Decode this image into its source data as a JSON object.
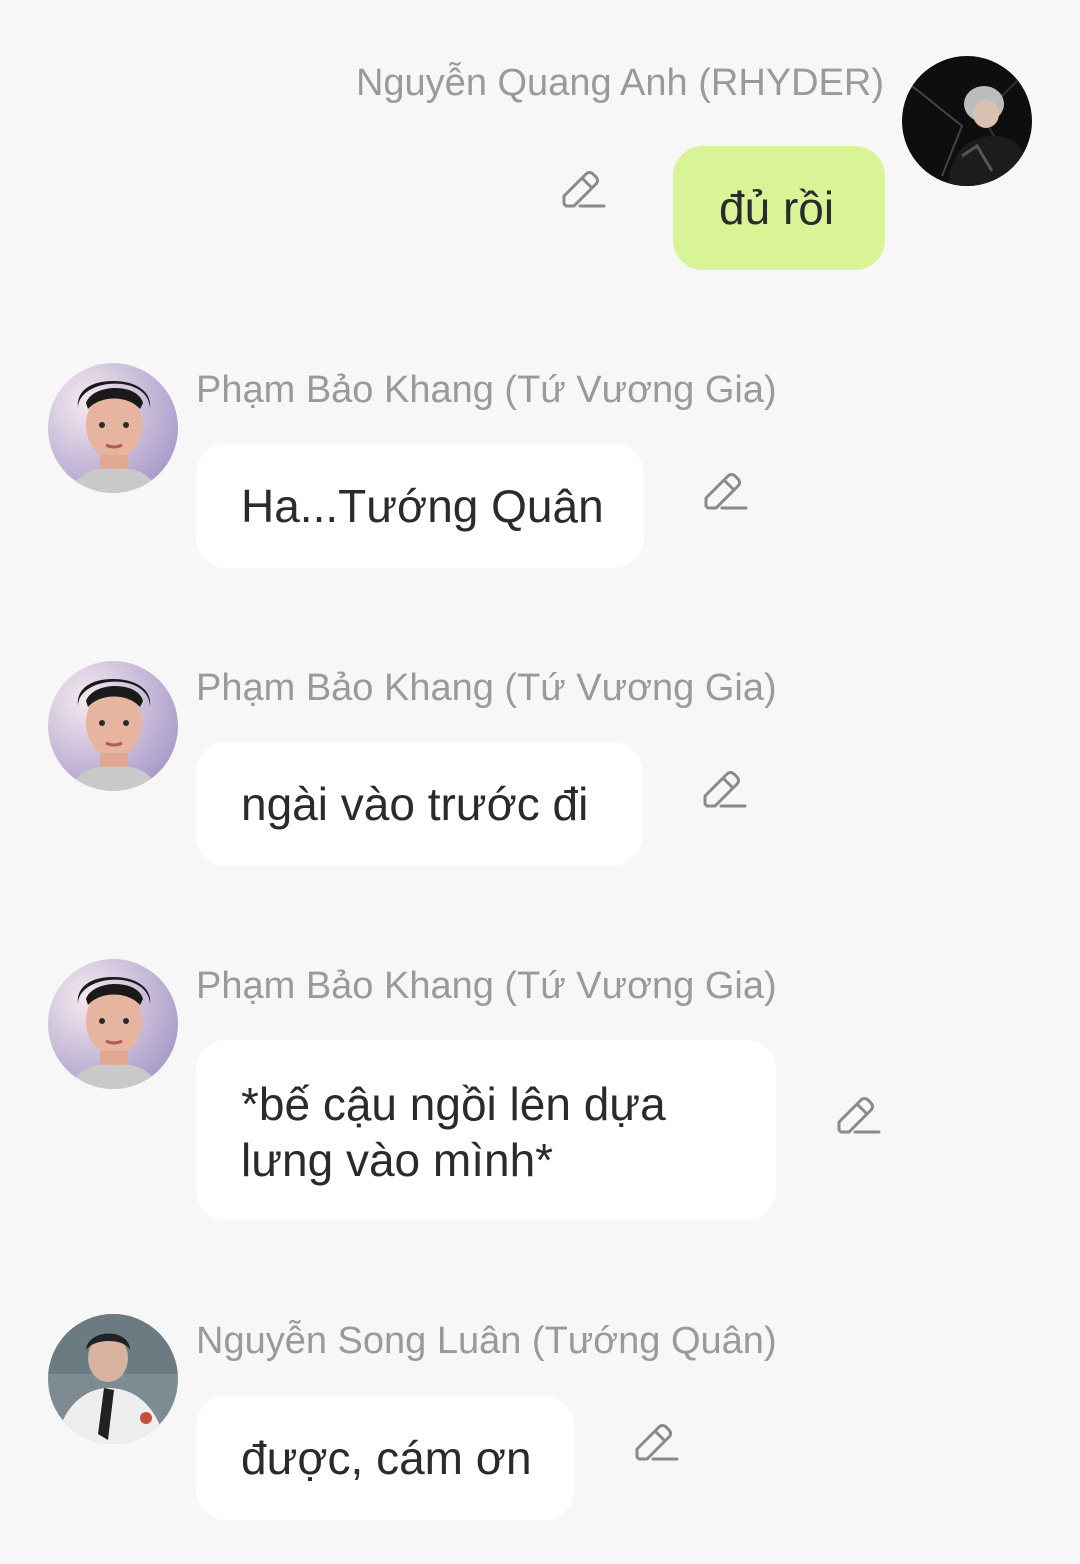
{
  "messages": [
    {
      "sender": "Nguyễn Quang Anh (RHYDER)",
      "text": "đủ rồi",
      "avatar": "rhyder-avatar",
      "side": "right"
    },
    {
      "sender": "Phạm Bảo Khang (Tứ Vương Gia)",
      "text": "Ha...Tướng Quân",
      "avatar": "khang-avatar",
      "side": "left"
    },
    {
      "sender": "Phạm Bảo Khang (Tứ Vương Gia)",
      "text": "ngài vào trước đi",
      "avatar": "khang-avatar",
      "side": "left"
    },
    {
      "sender": "Phạm Bảo Khang (Tứ Vương Gia)",
      "text": "*bế cậu ngồi lên dựa lưng vào mình*",
      "avatar": "khang-avatar",
      "side": "left"
    },
    {
      "sender": "Nguyễn Song Luân (Tướng Quân)",
      "text": "được, cám ơn",
      "avatar": "luan-avatar",
      "side": "left"
    }
  ],
  "colors": {
    "background": "#f7f7f7",
    "my_bubble": "#d8f496",
    "other_bubble": "#ffffff",
    "sender_text": "#9a9a9a",
    "message_text": "#2b2b2b",
    "edit_icon": "#8a8a8a"
  },
  "icons": {
    "edit": "pencil-edit-icon"
  }
}
